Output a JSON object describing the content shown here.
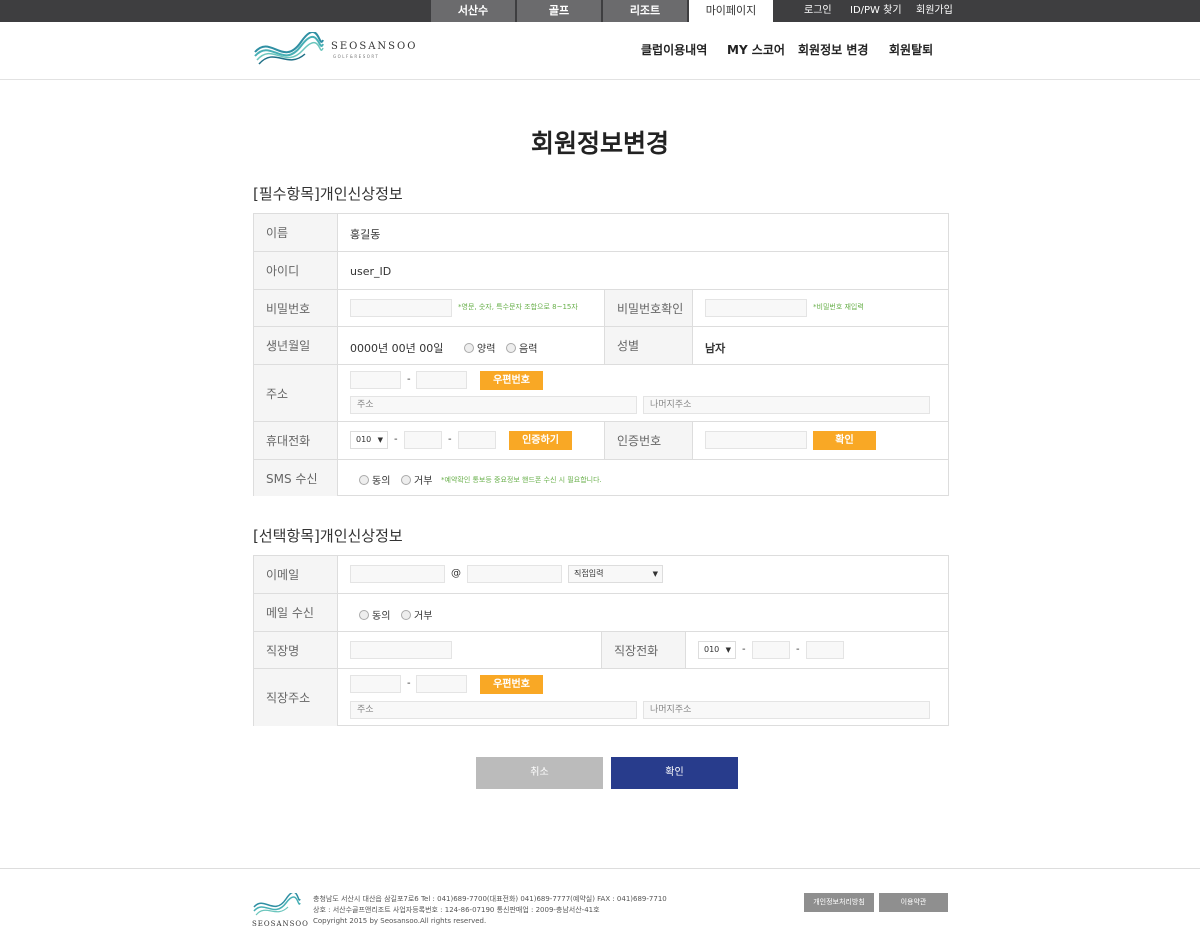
{
  "topbar": {
    "tabs": [
      "서산수",
      "골프",
      "리조트",
      "마이페이지"
    ],
    "links": [
      "로그인",
      "ID/PW 찾기",
      "회원가입"
    ]
  },
  "header": {
    "logo_text": "SEOSANSOO",
    "logo_sub": "GOLF&RESORT",
    "nav": [
      "클럽이용내역",
      "MY 스코어",
      "회원정보 변경",
      "회원탈퇴"
    ]
  },
  "page_title": "회원정보변경",
  "required": {
    "title": "[필수항목]개인신상정보",
    "name_label": "이름",
    "name_value": "홍길동",
    "id_label": "아이디",
    "id_value": "user_ID",
    "pw_label": "비밀번호",
    "pw_hint": "*영문, 숫자, 특수문자 조합으로 8~15자",
    "pw_confirm_label": "비밀번호확인",
    "pw_confirm_hint": "*비밀번호 재입력",
    "birth_label": "생년월일",
    "birth_value": "0000년 00년 00일",
    "solar": "양력",
    "lunar": "음력",
    "gender_label": "성별",
    "gender_value": "남자",
    "address_label": "주소",
    "zip_button": "우편번호",
    "address_placeholder": "주소",
    "address_rest_placeholder": "나머지주소",
    "phone_label": "휴대전화",
    "phone_prefix": "010",
    "verify_button": "인증하기",
    "auth_label": "인증번호",
    "confirm_button": "확인",
    "sms_label": "SMS 수신",
    "agree": "동의",
    "refuse": "거부",
    "sms_hint": "*예약확인 통보등 중요정보 핸드폰 수신 시 필요합니다."
  },
  "optional": {
    "title": "[선택항목]개인신상정보",
    "email_label": "이메일",
    "at": "@",
    "email_select": "직접입력",
    "mail_label": "메일 수신",
    "agree": "동의",
    "refuse": "거부",
    "company_label": "직장명",
    "company_phone_label": "직장전화",
    "phone_prefix": "010",
    "company_address_label": "직장주소",
    "zip_button": "우편번호",
    "address_placeholder": "주소",
    "address_rest_placeholder": "나머지주소"
  },
  "actions": {
    "cancel": "취소",
    "ok": "확인"
  },
  "footer": {
    "logo_text": "SEOSANSOO",
    "line1": "충청남도 서산시 대산읍 삼길포7로6 Tel : 041)689-7700(대표전화) 041)689-7777(예약실) FAX : 041)689-7710",
    "line2": "상호 : 서산수골프앤리조트 사업자등록번호 : 124-86-07190 통신판매업 : 2009-충남서산-41호",
    "line3": "Copyright 2015 by Seosansoo.All rights reserved.",
    "privacy_button": "개인정보처리방침",
    "terms_button": "이용약관"
  },
  "colors": {
    "accent_yellow": "#f9a825",
    "primary_blue": "#283c8c",
    "hint_green": "#6ab04c"
  }
}
